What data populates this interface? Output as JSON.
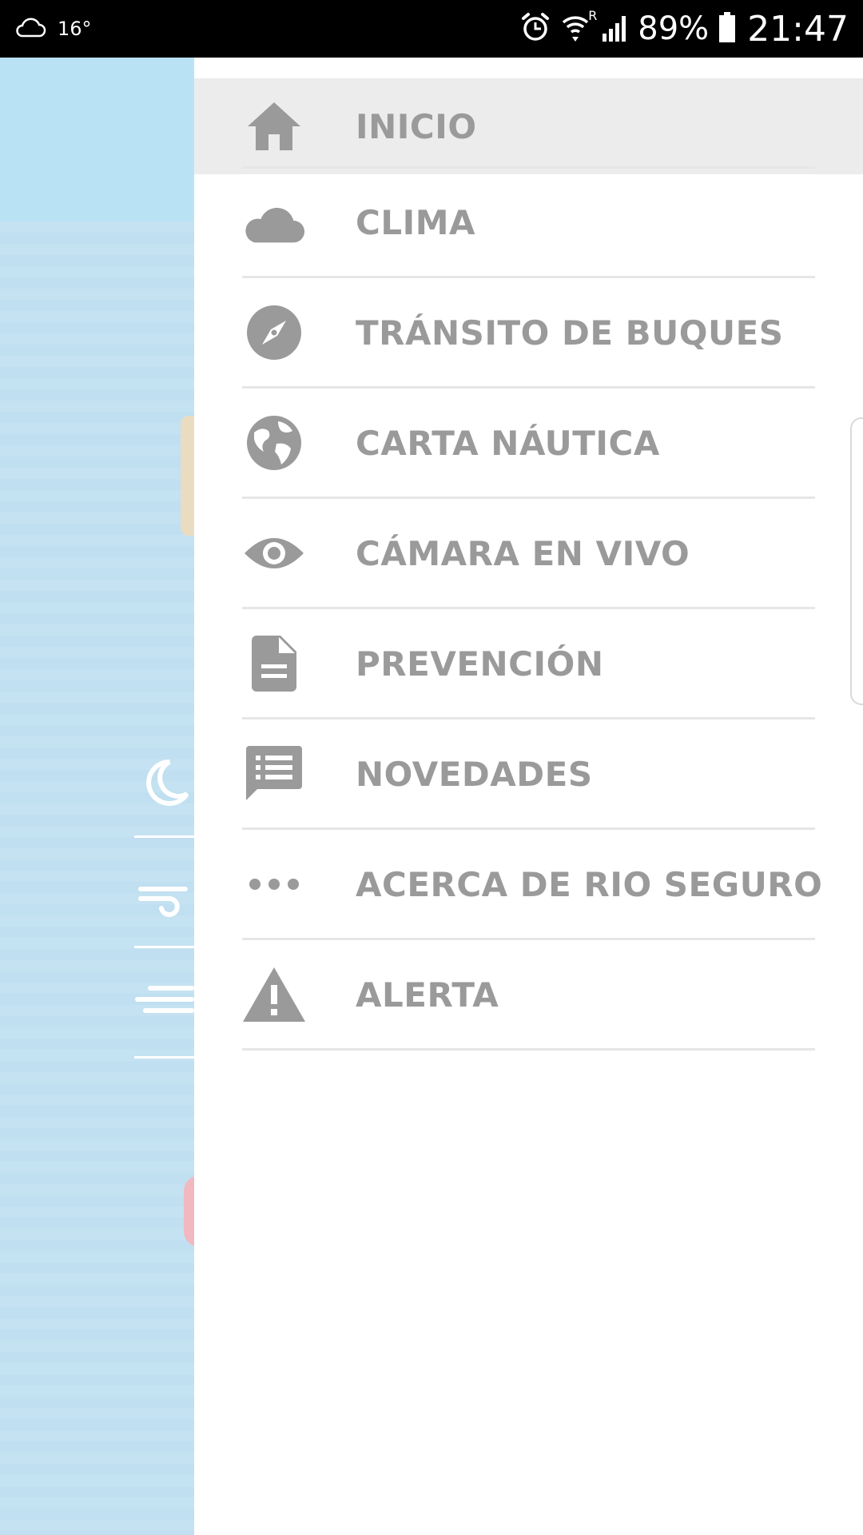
{
  "status_bar": {
    "weather_icon": "cloud-outline-icon",
    "temperature": "16°",
    "battery_percent": "89%",
    "time": "21:47",
    "network_roaming": "R"
  },
  "drawer": {
    "items": [
      {
        "label": "INICIO",
        "icon": "home-icon",
        "active": true
      },
      {
        "label": "CLIMA",
        "icon": "cloud-icon"
      },
      {
        "label": "TRÁNSITO DE BUQUES",
        "icon": "compass-icon"
      },
      {
        "label": "CARTA NÁUTICA",
        "icon": "globe-icon"
      },
      {
        "label": "CÁMARA EN VIVO",
        "icon": "eye-icon"
      },
      {
        "label": "PREVENCIÓN",
        "icon": "document-icon"
      },
      {
        "label": "NOVEDADES",
        "icon": "chat-list-icon"
      },
      {
        "label": "ACERCA DE RIO SEGURO",
        "icon": "more-dots-icon"
      },
      {
        "label": "ALERTA",
        "icon": "warning-icon"
      }
    ]
  },
  "colors": {
    "status_bar_bg": "#000000",
    "background_sky": "#b9e3f4",
    "background_water": "#c4e2f1",
    "drawer_bg": "#ffffff",
    "active_item_bg": "#ececec",
    "icon_text_gray": "#9a9a9a",
    "divider": "#e6e6e6"
  }
}
